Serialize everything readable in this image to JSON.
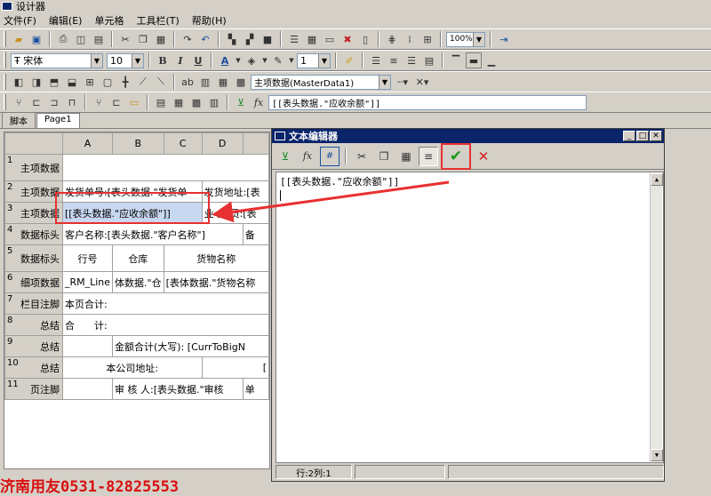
{
  "window": {
    "title": "设计器"
  },
  "menu": [
    "文件(F)",
    "编辑(E)",
    "单元格",
    "工具栏(T)",
    "帮助(H)"
  ],
  "toolbar2": {
    "font_name": "宋体",
    "font_size": "10",
    "zoom": "100%",
    "line_width": "1"
  },
  "toolbar3": {
    "data_source": "主项数据(MasterData1)"
  },
  "toolbar4": {
    "fx_label": "fx",
    "formula": "[[表头数据.\"应收余额\"]]"
  },
  "tabs": [
    "脚本",
    "Page1"
  ],
  "sheet": {
    "columns": [
      "A",
      "B",
      "C",
      "D"
    ],
    "rows": [
      {
        "num": "1",
        "label": "主项数据",
        "cells": [
          ""
        ]
      },
      {
        "num": "2",
        "label": "主项数据",
        "cells": [
          "发货单号:[表头数据.\"发货单",
          "发货地址:[表"
        ]
      },
      {
        "num": "3",
        "label": "主项数据",
        "cells": [
          "[[表头数据.\"应收余额\"]]",
          "业 务 员:[表"
        ]
      },
      {
        "num": "4",
        "label": "数据标头",
        "cells": [
          "客户名称:[表头数据.\"客户名称\"]",
          "备"
        ]
      },
      {
        "num": "5",
        "label": "数据标头",
        "cells": [
          "行号",
          "仓库",
          "货物名称"
        ]
      },
      {
        "num": "6",
        "label": "细项数据",
        "cells": [
          "_RM_Line",
          "体数据.\"仓",
          "[表体数据.\"货物名称"
        ]
      },
      {
        "num": "7",
        "label": "栏目注脚",
        "cells": [
          "本页合计:"
        ]
      },
      {
        "num": "8",
        "label": "总结",
        "cells": [
          "合　　计:"
        ]
      },
      {
        "num": "9",
        "label": "总结",
        "cells": [
          "",
          "金额合计(大写): [CurrToBigN"
        ]
      },
      {
        "num": "10",
        "label": "总结",
        "cells": [
          "本公司地址:",
          "["
        ]
      },
      {
        "num": "11",
        "label": "页注脚",
        "cells": [
          "",
          "审 核 人:[表头数据.\"审核",
          "单"
        ]
      }
    ]
  },
  "editor": {
    "title": "文本编辑器",
    "fx_label": "fx",
    "content": "[[表头数据.\"应收余额\"]]",
    "status_pos": "行:2列:1"
  },
  "watermark": "济南用友0531-82825553",
  "colors": {
    "highlight": "#e83030",
    "titlebar": "#0a246a",
    "confirm": "#1a9a1a",
    "cancel": "#d02020"
  }
}
